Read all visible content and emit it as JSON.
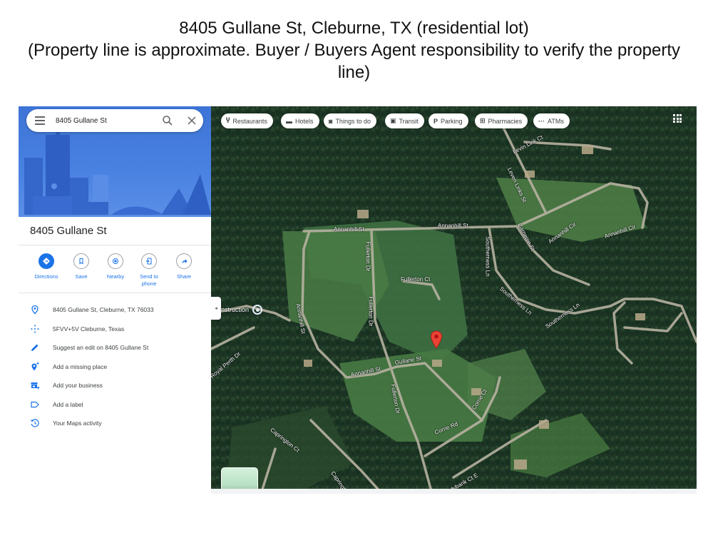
{
  "slide": {
    "title_line1": "8405 Gullane St, Cleburne, TX (residential lot)",
    "title_line2": "(Property line is approximate.  Buyer / Buyers Agent responsibility to verify the property line)"
  },
  "search": {
    "value": "8405 Gullane St",
    "menu_icon": "hamburger-menu-icon",
    "search_icon": "search-icon",
    "clear_icon": "close-icon"
  },
  "place": {
    "title": "8405 Gullane St"
  },
  "actions": [
    {
      "label": "Directions",
      "icon": "directions-icon"
    },
    {
      "label": "Save",
      "icon": "bookmark-icon"
    },
    {
      "label": "Nearby",
      "icon": "nearby-icon"
    },
    {
      "label": "Send to phone",
      "icon": "send-to-phone-icon"
    },
    {
      "label": "Share",
      "icon": "share-icon"
    }
  ],
  "info_items": [
    {
      "text": "8405 Gullane St, Cleburne, TX 76033",
      "icon": "location-pin-icon"
    },
    {
      "text": "5FVV+5V Cleburne, Texas",
      "icon": "plus-code-icon"
    },
    {
      "text": "Suggest an edit on 8405 Gullane St",
      "icon": "pencil-icon"
    },
    {
      "text": "Add a missing place",
      "icon": "add-place-icon"
    },
    {
      "text": "Add your business",
      "icon": "add-business-icon"
    },
    {
      "text": "Add a label",
      "icon": "label-icon"
    },
    {
      "text": "Your Maps activity",
      "icon": "history-icon"
    }
  ],
  "map": {
    "chips": [
      {
        "label": "Restaurants",
        "glyph": "🍴",
        "icon": "restaurant-icon"
      },
      {
        "label": "Hotels",
        "glyph": "🛏",
        "icon": "hotel-icon"
      },
      {
        "label": "Things to do",
        "glyph": "📷",
        "icon": "camera-icon"
      },
      {
        "label": "Transit",
        "glyph": "🚆",
        "icon": "transit-icon"
      },
      {
        "label": "Parking",
        "glyph": "P",
        "icon": "parking-icon"
      },
      {
        "label": "Pharmacies",
        "glyph": "⊞",
        "icon": "pharmacy-icon"
      },
      {
        "label": "ATMs",
        "glyph": "···",
        "icon": "atm-icon"
      }
    ],
    "poi_label": "nstruction",
    "collapse_glyph": "◂",
    "road_labels": {
      "annanhill_st_1": "Annanhill St",
      "annanhill_st_2": "Annanhill St",
      "annanhill_st_3": "Annanhill St",
      "annanhill_st_4": "Annanhill St",
      "fullerton_dr_1": "Fullerton Dr",
      "fullerton_dr_2": "Fullerton Dr",
      "fullerton_dr_3": "Fullerton Dr",
      "fullerton_ct": "Fullerton Ct",
      "gullane_st": "Gullane St",
      "corrie_ct": "Corrie Ct",
      "corrie_rd": "Corrie Rd",
      "southerness_ln_1": "Southerness Ln",
      "southerness_ln_2": "Southerness Ln",
      "southerness_ln_3": "Southerness Ln",
      "levin_link_ct": "Levin Link Ct",
      "leven_links_st": "Leven Links St",
      "carnegie_st": "Carnegie St",
      "annanhill_cir_1": "Annanhill Cir",
      "annanhill_cir_2": "Annanhill Cir",
      "royal_perth_dr": "Royal Perth Dr",
      "caprington_ct_1": "Caprington Ct",
      "caprington_ct_2": "Caprington Ct",
      "ladybank_ct_e": "Ladybank Ct E"
    }
  },
  "colors": {
    "accent": "#1a73e8",
    "pin": "#ea4335",
    "hero": "#4a82e2"
  }
}
